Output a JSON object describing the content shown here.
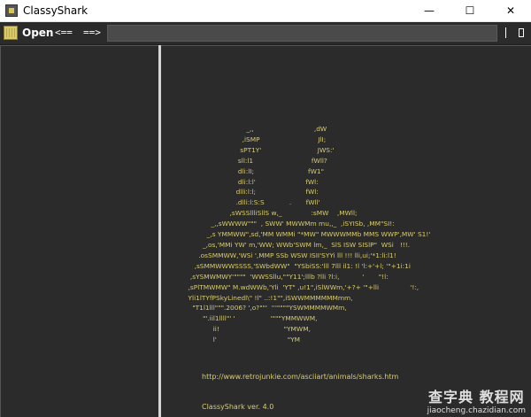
{
  "window": {
    "title": "ClassyShark",
    "minimize_glyph": "—",
    "maximize_glyph": "☐",
    "close_glyph": "✕"
  },
  "toolbar": {
    "open_label": "Open",
    "back_label": "<==",
    "forward_label": "==>",
    "search_value": "",
    "icons": [
      "open-file-icon",
      "panel-toggle-icon"
    ]
  },
  "content": {
    "ascii_art": "                                         _,,                             ,dW\n                                       ,iSMP                            JlI;\n                                      sPT1Y'                           JWS:'\n                                     sll:l1                            fWll?\n                                     dli:lI;                          fW1\"\n                                     dli:l:l'                        fWl:\n                                    dlli:l:l;                        fWl:\n                                    .dlli:l:S:S            .       fWll'\n                                 ,sWSSllliSllS w,_              :sMW    ,MWll;\n                        _,,sWWWW\"\"\"  , SWW' MWWMm mu,,_  ,iSYISb, ,MM\"SI!:\n                      _,s YMMWW\",sd,'MM WMMi \"*MW\" MWWWMMb MMS WWP',MW' S1!'\n                    _,os,'MMi YW' m,'WW; WWb'SWM lm,_  SlS ISW SISlP\"  WSi   !!!.\n                  .osSMMWW,'WSi ',MMP SSb WSW ISII'SYYi lll !!! lli,ui;'*1:li:l1!\n                ,sSMMWWWSSSS,'SWbdWW\"  \"YSbiSS:'lll 7lll il1: !l 'l:+'+l; '\"+1i:1i\n              ,sYSMWMWY'\"\"\"\"  'WWSSllu,\"\"Y11';lllb ?lli ?l:i,           '       \"!l:\n             ,sPlTMWMW\" M.wdWWb,'Yli  'YT\" ,u!1\",iSlWWm,'+?+ '\"+lli               '!:,\n             Yli1lTYfPSkyLinedl\\\" !l\" ..:!1\"\",iSWWMMMMMMmm,\n               \"T1l1lll\"\"\".2006? ',o?\"\"'  '''\"\"\"\"YSWMMMMWMm,\n                    \"'.iil1llll\"' '                 '\"\"\"YMMWWM,\n                         ii!                               \"YMWM,\n                         l'                                  \"YM",
    "url": "http://www.retrojunkie.com/asciiart/animals/sharks.htm",
    "version": "ClassyShark ver. 4.0"
  },
  "watermark": {
    "top": "查字典 教程网",
    "bottom": "jiaocheng.chazidian.com"
  },
  "colors": {
    "panel_bg": "#2b2b2b",
    "art_text": "#d9cc72",
    "toolbar_text": "#ffffff",
    "divider": "#d6d6d6"
  }
}
